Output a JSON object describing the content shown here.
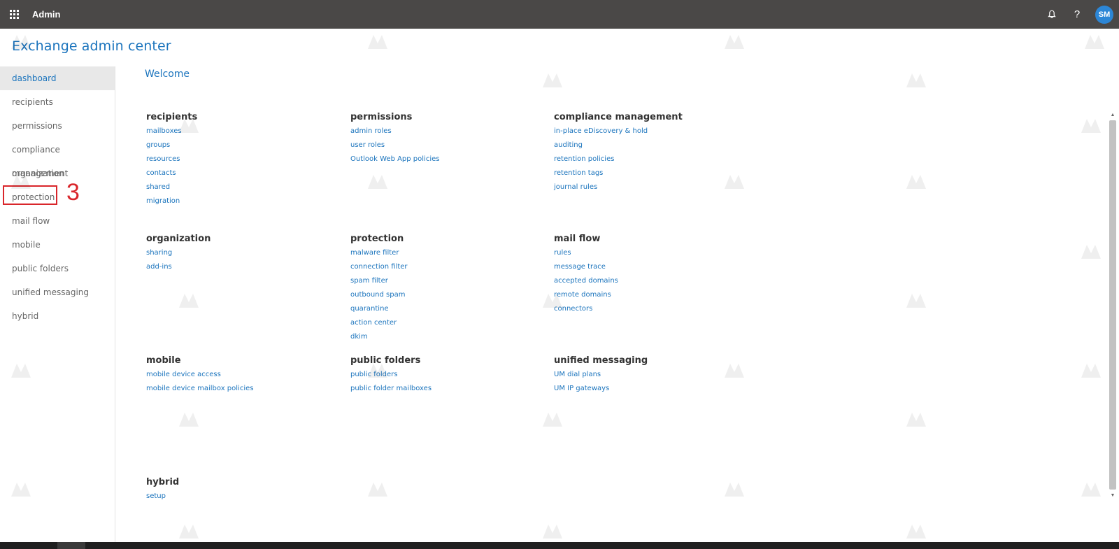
{
  "topbar": {
    "app_name": "Admin",
    "avatar_initials": "SM"
  },
  "page_title": "Exchange admin center",
  "sidebar": {
    "items": [
      {
        "label": "dashboard",
        "active": true
      },
      {
        "label": "recipients"
      },
      {
        "label": "permissions"
      },
      {
        "label": "compliance management"
      },
      {
        "label": "organization"
      },
      {
        "label": "protection"
      },
      {
        "label": "mail flow"
      },
      {
        "label": "mobile"
      },
      {
        "label": "public folders"
      },
      {
        "label": "unified messaging"
      },
      {
        "label": "hybrid"
      }
    ]
  },
  "annotation": {
    "step_number": "3"
  },
  "main": {
    "welcome": "Welcome",
    "sections": [
      {
        "title": "recipients",
        "links": [
          "mailboxes",
          "groups",
          "resources",
          "contacts",
          "shared",
          "migration"
        ]
      },
      {
        "title": "permissions",
        "links": [
          "admin roles",
          "user roles",
          "Outlook Web App policies"
        ]
      },
      {
        "title": "compliance management",
        "links": [
          "in-place eDiscovery & hold",
          "auditing",
          "retention policies",
          "retention tags",
          "journal rules"
        ]
      },
      {
        "title": "organization",
        "links": [
          "sharing",
          "add-ins"
        ]
      },
      {
        "title": "protection",
        "links": [
          "malware filter",
          "connection filter",
          "spam filter",
          "outbound spam",
          "quarantine",
          "action center",
          "dkim"
        ]
      },
      {
        "title": "mail flow",
        "links": [
          "rules",
          "message trace",
          "accepted domains",
          "remote domains",
          "connectors"
        ]
      },
      {
        "title": "mobile",
        "links": [
          "mobile device access",
          "mobile device mailbox policies"
        ]
      },
      {
        "title": "public folders",
        "links": [
          "public folders",
          "public folder mailboxes"
        ]
      },
      {
        "title": "unified messaging",
        "links": [
          "UM dial plans",
          "UM IP gateways"
        ]
      },
      {
        "title": "hybrid",
        "links": [
          "setup"
        ]
      }
    ]
  }
}
